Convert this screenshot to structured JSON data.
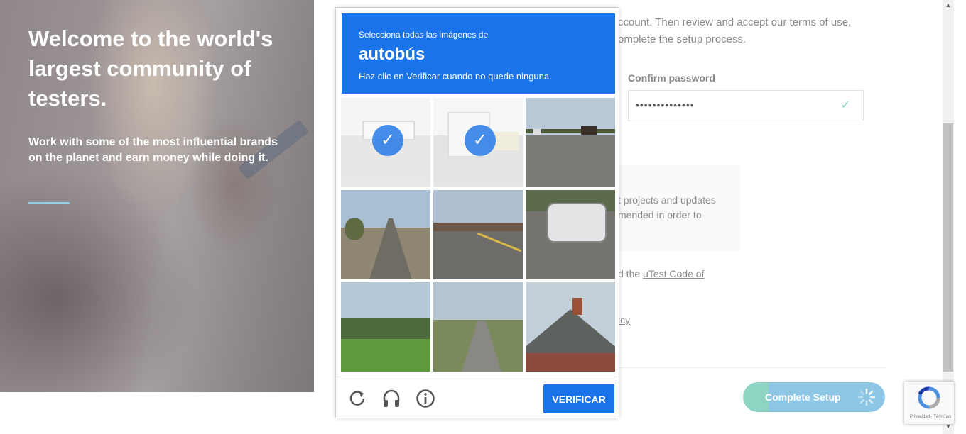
{
  "hero": {
    "headline": "Welcome to the world's largest community of testers.",
    "subtext": "Work with some of the most influential brands on the planet and earn money while doing it.",
    "accent_color": "#8fd0e6"
  },
  "form": {
    "intro_line1": "ccount. Then review and accept our terms of use,",
    "intro_line2": "omplete the setup process.",
    "confirm_password_label": "Confirm password",
    "confirm_password_value": "••••••••••••••",
    "info_line1": "t projects and updates",
    "info_line2": "mended in order to",
    "terms_prefix": "d the ",
    "terms_link": "uTest Code of",
    "policy_link": "icy",
    "complete_button": "Complete Setup"
  },
  "captcha": {
    "instruction_line1": "Selecciona todas las imágenes de",
    "target_word": "autobús",
    "instruction_line2": "Haz clic en Verificar cuando no quede ninguna.",
    "verify_button": "VERIFICAR",
    "header_color": "#1a73e8",
    "tiles": [
      {
        "selected": true,
        "scene": "street-bus"
      },
      {
        "selected": true,
        "scene": "street-bus"
      },
      {
        "selected": false,
        "scene": "road-cars"
      },
      {
        "selected": false,
        "scene": "road-palms"
      },
      {
        "selected": false,
        "scene": "road-town"
      },
      {
        "selected": false,
        "scene": "parked-van"
      },
      {
        "selected": false,
        "scene": "palm-trees"
      },
      {
        "selected": false,
        "scene": "residential-street"
      },
      {
        "selected": false,
        "scene": "house-roof"
      }
    ],
    "icons": [
      "reload-icon",
      "headphones-icon",
      "info-icon"
    ]
  },
  "recaptcha_badge": {
    "footer": "Privacidad - Términos"
  }
}
